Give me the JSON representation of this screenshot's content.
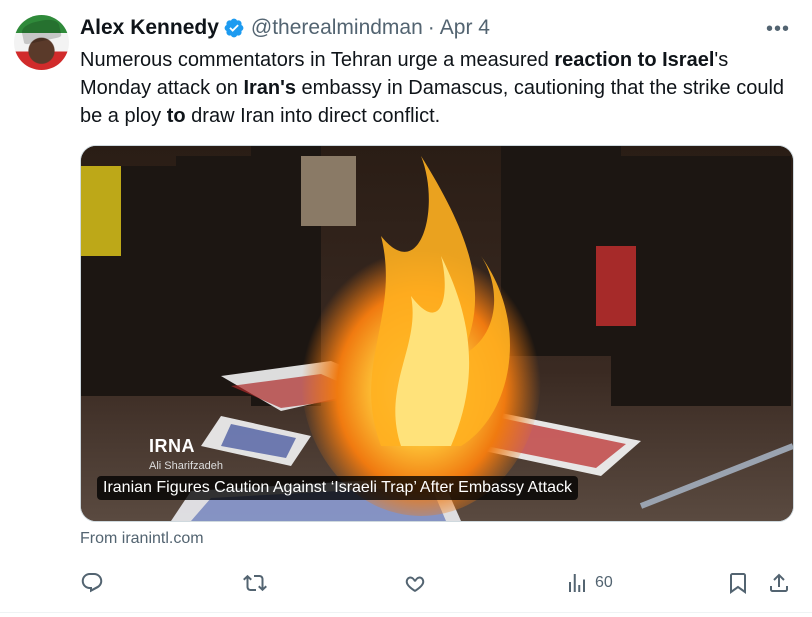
{
  "tweet": {
    "author_name": "Alex Kennedy",
    "handle": "@therealmindman",
    "separator": "·",
    "date": "Apr 4",
    "more_label": "•••",
    "text_parts": [
      "Numerous commentators in Tehran urge a measured ",
      "reaction to Israel",
      "'s Monday attack on ",
      "Iran's",
      " embassy in Damascus, cautioning that the strike could be a ploy ",
      "to",
      " draw Iran into direct conflict."
    ]
  },
  "card": {
    "watermark": "IRNA",
    "photo_credit": "Ali Sharifzadeh",
    "caption": "Iranian Figures Caution Against ‘Israeli Trap’ After Embassy Attack",
    "source": "From iranintl.com"
  },
  "actions": {
    "reply_icon": "reply-icon",
    "retweet_icon": "retweet-icon",
    "like_icon": "heart-icon",
    "views_icon": "views-icon",
    "views_count": "60",
    "bookmark_icon": "bookmark-icon",
    "share_icon": "share-icon"
  },
  "colors": {
    "text": "#0f1419",
    "secondary": "#536471",
    "verified": "#1d9bf0",
    "border": "#cfd9de"
  }
}
